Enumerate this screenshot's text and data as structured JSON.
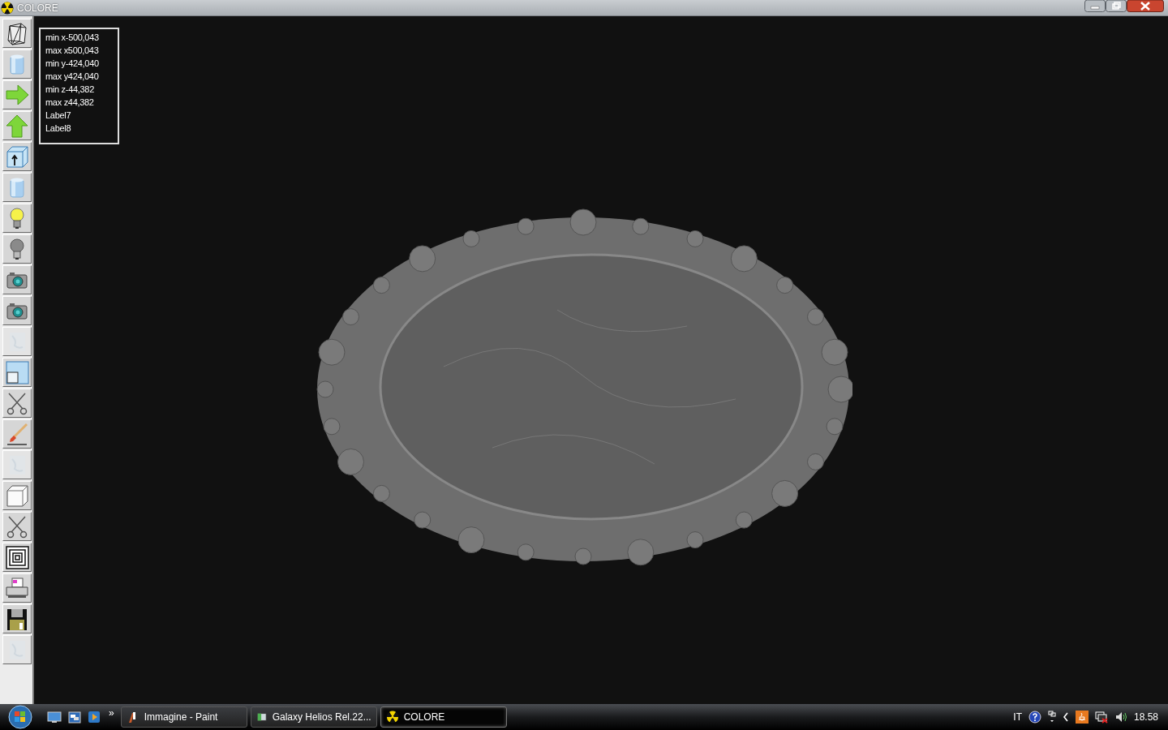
{
  "window": {
    "title": "COLORE"
  },
  "toolbar": [
    {
      "kind": "wireframe",
      "disabled": false
    },
    {
      "kind": "cylinder",
      "disabled": false
    },
    {
      "kind": "arrow-right",
      "disabled": false
    },
    {
      "kind": "arrow-up",
      "disabled": false
    },
    {
      "kind": "box-arrow",
      "disabled": false
    },
    {
      "kind": "cylinder",
      "disabled": false
    },
    {
      "kind": "bulb-on",
      "disabled": false
    },
    {
      "kind": "bulb-off",
      "disabled": false
    },
    {
      "kind": "camera",
      "disabled": false
    },
    {
      "kind": "camera",
      "disabled": false
    },
    {
      "kind": "texture",
      "disabled": true
    },
    {
      "kind": "window",
      "disabled": false
    },
    {
      "kind": "scissors",
      "disabled": false
    },
    {
      "kind": "brush",
      "disabled": false
    },
    {
      "kind": "texture",
      "disabled": true
    },
    {
      "kind": "cube",
      "disabled": false
    },
    {
      "kind": "scissors",
      "disabled": false
    },
    {
      "kind": "squares",
      "disabled": false
    },
    {
      "kind": "printer",
      "disabled": false
    },
    {
      "kind": "floppy",
      "disabled": false
    },
    {
      "kind": "texture",
      "disabled": true
    }
  ],
  "viewport": {
    "labels": [
      "min x-500,043",
      "max x500,043",
      "min y-424,040",
      "max y424,040",
      "min z-44,382",
      "max z44,382",
      "Label7",
      "Label8"
    ]
  },
  "taskbar": {
    "more": "»",
    "tasks": [
      {
        "kind": "paint",
        "label": "Immagine - Paint",
        "selected": false
      },
      {
        "kind": "window",
        "label": "Galaxy Helios  Rel.22...",
        "selected": false
      },
      {
        "kind": "radiation",
        "label": "COLORE",
        "selected": true
      }
    ],
    "tray": {
      "language": "IT",
      "clock": "18.58"
    }
  }
}
